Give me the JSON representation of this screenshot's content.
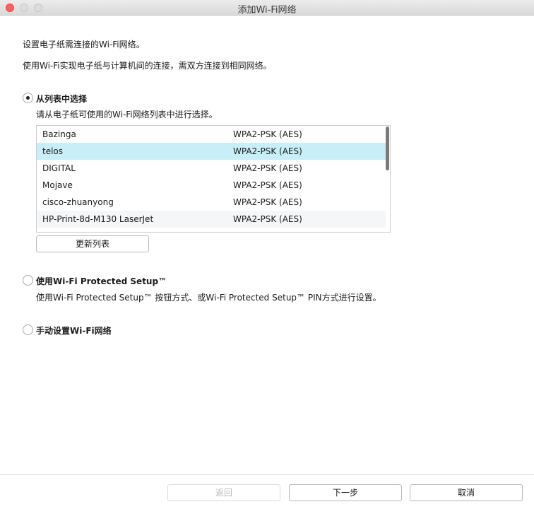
{
  "window": {
    "title": "添加Wi-Fi网络"
  },
  "intro": {
    "line1": "设置电子纸需连接的Wi-Fi网络。",
    "line2": "使用Wi-Fi实现电子纸与计算机间的连接，需双方连接到相同网络。"
  },
  "options": {
    "list": {
      "label": "从列表中选择",
      "description": "请从电子纸可使用的Wi-Fi网络列表中进行选择。",
      "selected": true
    },
    "wps": {
      "label": "使用Wi-Fi Protected Setup™",
      "description": "使用Wi-Fi Protected Setup™ 按钮方式、或Wi-Fi Protected Setup™ PIN方式进行设置。",
      "selected": false
    },
    "manual": {
      "label": "手动设置Wi-Fi网络",
      "selected": false
    }
  },
  "networks": [
    {
      "ssid": "Bazinga",
      "security": "WPA2-PSK (AES)"
    },
    {
      "ssid": "telos",
      "security": "WPA2-PSK (AES)",
      "selected": true
    },
    {
      "ssid": "DIGITAL",
      "security": "WPA2-PSK (AES)"
    },
    {
      "ssid": "Mojave",
      "security": "WPA2-PSK (AES)"
    },
    {
      "ssid": "cisco-zhuanyong",
      "security": "WPA2-PSK (AES)"
    },
    {
      "ssid": "HP-Print-8d-M130 LaserJet",
      "security": "WPA2-PSK (AES)"
    }
  ],
  "buttons": {
    "refresh": "更新列表",
    "back": "返回",
    "next": "下一步",
    "cancel": "取消"
  },
  "colors": {
    "selected_row": "#c8eef8",
    "close_button": "#fc605b"
  }
}
